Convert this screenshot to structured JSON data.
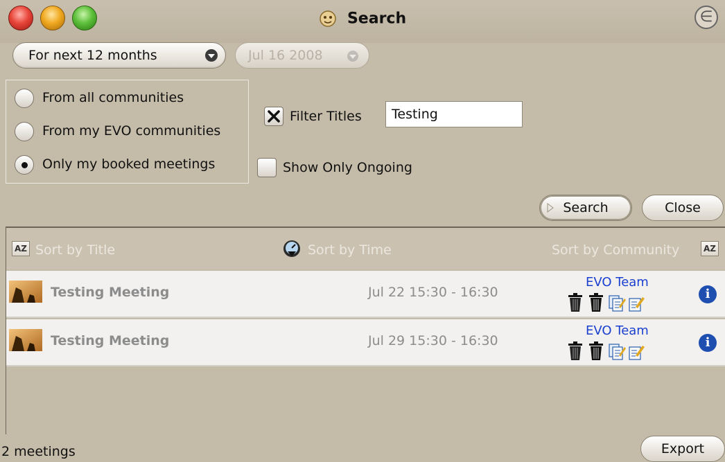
{
  "window": {
    "title": "Search",
    "title_icon": "evo-app-icon",
    "logo_glyph": "∈"
  },
  "filters": {
    "range_select": "For next 12 months",
    "date_select": "Jul 16 2008",
    "radio_options": [
      {
        "label": "From all communities",
        "selected": false
      },
      {
        "label": "From my EVO communities",
        "selected": false
      },
      {
        "label": "Only my booked meetings",
        "selected": true
      }
    ],
    "filter_titles": {
      "label": "Filter Titles",
      "checked": true,
      "value": "Testing"
    },
    "show_only_ongoing": {
      "label": "Show Only Ongoing",
      "checked": false
    }
  },
  "buttons": {
    "search": "Search",
    "close": "Close",
    "export": "Export"
  },
  "sortbar": {
    "by_title": "Sort by Title",
    "by_time": "Sort by Time",
    "by_community": "Sort by Community",
    "az": "AZ"
  },
  "meetings": [
    {
      "title": "Testing Meeting",
      "time": "Jul 22 15:30 - 16:30",
      "community": "EVO Team"
    },
    {
      "title": "Testing Meeting",
      "time": "Jul 29 15:30 - 16:30",
      "community": "EVO Team"
    }
  ],
  "footer": {
    "count": "2 meetings"
  },
  "colors": {
    "window_bg": "#c5bba9",
    "community_link": "#1a3fd0",
    "info_blue": "#1e4fb0"
  }
}
